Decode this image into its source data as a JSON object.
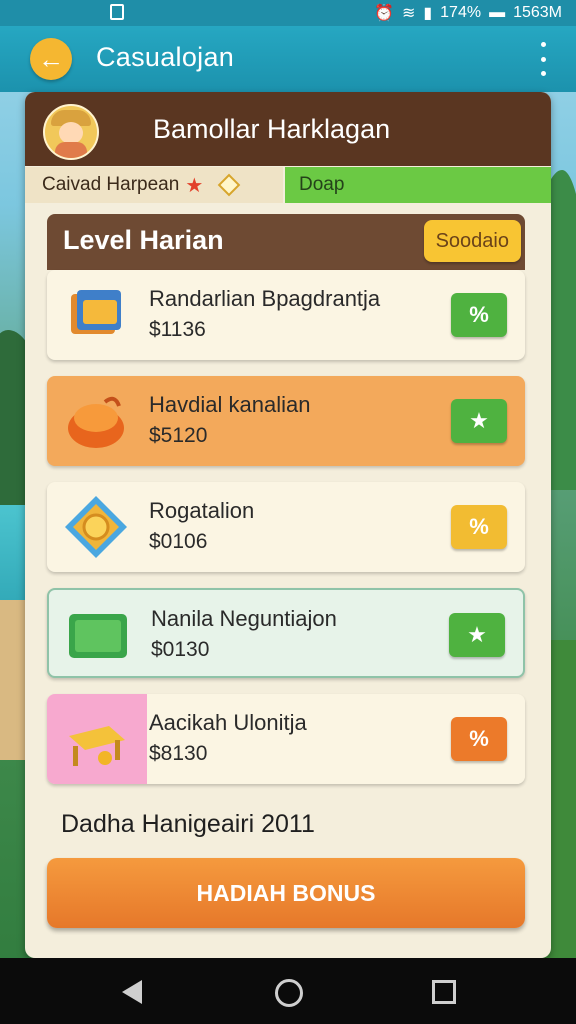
{
  "status_bar": {
    "battery": "174%",
    "time": "1563M"
  },
  "app_bar": {
    "title": "Casualojan"
  },
  "card": {
    "title": "Bamollar Harklagan"
  },
  "tabs": {
    "left_label": "Caivad Harpean",
    "right_label": "Doap"
  },
  "level": {
    "title": "Level Harian",
    "button_label": "Soodaio",
    "items": [
      {
        "name": "Randarlian Bpagdrantja",
        "price": "$1136",
        "action": "%",
        "bg": "#fbf5e3",
        "action_color": "#4fb240"
      },
      {
        "name": "Havdial kanalian",
        "price": "$5120",
        "action": "★",
        "bg": "#f3a95b",
        "action_color": "#4fb240"
      },
      {
        "name": "Rogatalion",
        "price": "$0106",
        "action": "%",
        "bg": "#fbf5e3",
        "action_color": "#f2bc32"
      },
      {
        "name": "Nanila Neguntiajon",
        "price": "$0130",
        "action": "★",
        "bg": "#e7f3e9",
        "action_color": "#4fb240"
      },
      {
        "name": "Aacikah Ulonitja",
        "price": "$8130",
        "action": "%",
        "bg": "#fbf5e3",
        "action_color": "#ec7a2a"
      }
    ]
  },
  "bonus": {
    "text": "Dadha Hanigeairi 2011",
    "button_label": "HADIAH BONUS"
  },
  "icons": [
    "back-arrow-icon",
    "more-vert-icon",
    "avatar",
    "star-icon",
    "diamond-icon",
    "stack-icon",
    "pot-icon",
    "emblem-icon",
    "gift-box-icon",
    "chair-icon"
  ]
}
